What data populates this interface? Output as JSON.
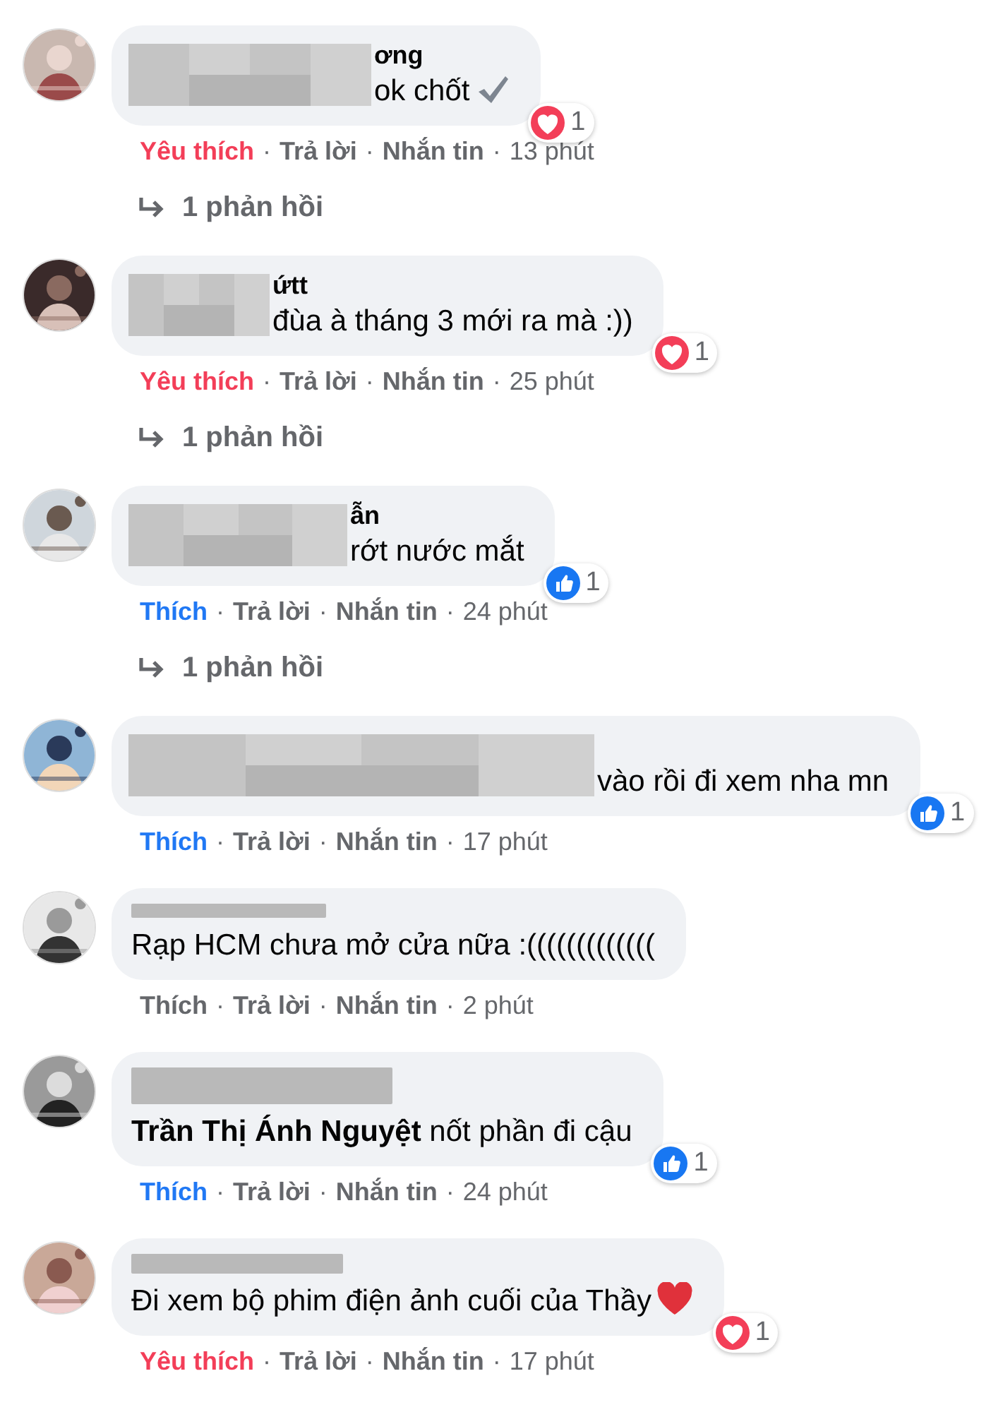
{
  "comments": [
    {
      "name_blur": {
        "kind": "mosaic"
      },
      "name_fragment": "ơng",
      "text": "ok chốt",
      "emoji": {
        "kind": "check"
      },
      "reaction_badge": {
        "kind": "love",
        "count": "1"
      },
      "actions": {
        "like": {
          "label": "Yêu thích",
          "kind": "love",
          "reacted": true
        },
        "reply": "Trả lời",
        "message": "Nhắn tin",
        "time": "13 phút",
        "separators": [
          "·",
          "·",
          "·"
        ]
      },
      "replies": "1 phản hồi"
    },
    {
      "name_blur": {
        "kind": "mosaic"
      },
      "name_fragment": "ứtt",
      "text": "đùa à tháng 3 mới ra mà :))",
      "reaction_badge": {
        "kind": "love",
        "count": "1"
      },
      "actions": {
        "like": {
          "label": "Yêu thích",
          "kind": "love",
          "reacted": true
        },
        "reply": "Trả lời",
        "message": "Nhắn tin",
        "time": "25 phút",
        "separators": [
          "·",
          "·",
          "·"
        ]
      },
      "replies": "1 phản hồi"
    },
    {
      "name_blur": {
        "kind": "mosaic"
      },
      "name_fragment": "ẫn",
      "text": "rớt nước mắt",
      "reaction_badge": {
        "kind": "like",
        "count": "1"
      },
      "actions": {
        "like": {
          "label": "Thích",
          "kind": "like",
          "reacted": true
        },
        "reply": "Trả lời",
        "message": "Nhắn tin",
        "time": "24 phút",
        "separators": [
          "·",
          "·",
          "·"
        ]
      },
      "replies": "1 phản hồi"
    },
    {
      "name_blur": {
        "kind": "mosaic"
      },
      "text": "vào rồi đi xem nha mn",
      "reaction_badge": {
        "kind": "like",
        "count": "1"
      },
      "actions": {
        "like": {
          "label": "Thích",
          "kind": "like",
          "reacted": true
        },
        "reply": "Trả lời",
        "message": "Nhắn tin",
        "time": "17 phút",
        "separators": [
          "·",
          "·",
          "·"
        ]
      }
    },
    {
      "name_blur": {
        "kind": "bar"
      },
      "text": "Rạp HCM chưa mở cửa nữa :(((((((((((((",
      "actions": {
        "like": {
          "label": "Thích",
          "kind": "like",
          "reacted": false
        },
        "reply": "Trả lời",
        "message": "Nhắn tin",
        "time": "2 phút",
        "separators": [
          "·",
          "·",
          "·"
        ]
      }
    },
    {
      "name_blur": {
        "kind": "bar"
      },
      "text": "**Trần Thị Ánh Nguyệt** nốt phần đi cậu",
      "reaction_badge": {
        "kind": "like",
        "count": "1"
      },
      "actions": {
        "like": {
          "label": "Thích",
          "kind": "like",
          "reacted": true
        },
        "reply": "Trả lời",
        "message": "Nhắn tin",
        "time": "24 phút",
        "separators": [
          "·",
          "·",
          "·"
        ]
      }
    },
    {
      "name_blur": {
        "kind": "bar"
      },
      "text": "Đi xem bộ phim điện ảnh cuối của Thầy",
      "emoji": {
        "kind": "heart"
      },
      "reaction_badge": {
        "kind": "love",
        "count": "1"
      },
      "actions": {
        "like": {
          "label": "Yêu thích",
          "kind": "love",
          "reacted": true
        },
        "reply": "Trả lời",
        "message": "Nhắn tin",
        "time": "17 phút",
        "separators": [
          "·",
          "·",
          "·"
        ]
      }
    }
  ]
}
